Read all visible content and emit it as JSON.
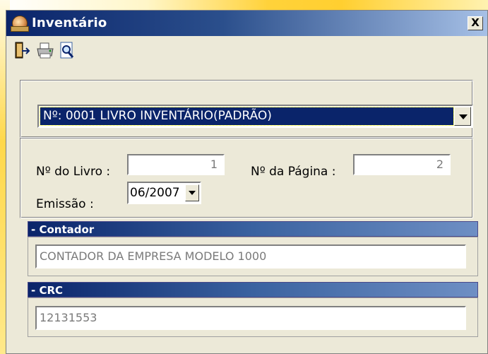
{
  "window": {
    "title": "Inventário",
    "close_label": "X"
  },
  "toolbar": {
    "buttons": [
      {
        "icon": "exit-door-icon"
      },
      {
        "icon": "printer-icon"
      },
      {
        "icon": "print-preview-icon"
      }
    ]
  },
  "book_selector": {
    "value": "Nº: 0001  LIVRO INVENTÁRIO(PADRÃO)"
  },
  "form": {
    "livro_label": "Nº do Livro :",
    "livro_value": "1",
    "pagina_label": "Nº da Página :",
    "pagina_value": "2",
    "emissao_label": "Emissão :",
    "emissao_value": "06/2007"
  },
  "contador": {
    "header": "- Contador",
    "value": "CONTADOR DA EMPRESA MODELO 1000"
  },
  "crc": {
    "header": "- CRC",
    "value": "12131553"
  },
  "colors": {
    "titlebar_start": "#0a246a",
    "titlebar_end": "#a6c0e6",
    "selection": "#0a246a",
    "window_bg": "#ece9d8",
    "backdrop": "#ffd23a"
  }
}
